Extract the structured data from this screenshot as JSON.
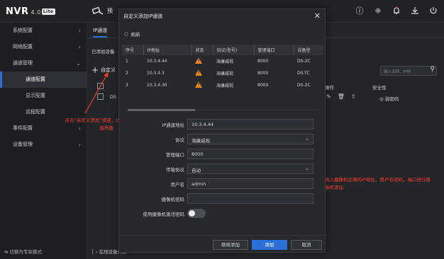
{
  "app": {
    "name": "NVR",
    "version": "4.0",
    "edition": "Lite"
  },
  "header": {
    "preview_label": "预",
    "icons": [
      "info-icon",
      "grid-icon",
      "bell-icon",
      "download-icon",
      "power-icon"
    ]
  },
  "sidebar": {
    "items": [
      {
        "label": "系统配置",
        "arrow": "›"
      },
      {
        "label": "网络配置",
        "arrow": "›"
      },
      {
        "label": "通道管理",
        "arrow": "⌄"
      },
      {
        "label": "通道配置"
      },
      {
        "label": "显示配置"
      },
      {
        "label": "远程配置"
      },
      {
        "label": "事件配置",
        "arrow": "›"
      },
      {
        "label": "设备管理",
        "arrow": "›"
      }
    ],
    "bottom": "⇆ 切换为专家模式"
  },
  "main": {
    "tab": "IP通道",
    "added_label": "已添加设备",
    "add_button": "自定义",
    "search_placeholder": "输入名称、IP地",
    "op_header": "操作",
    "security_header": "安全性",
    "weak_label": "弱密码",
    "bottom_list": "在线设备列表",
    "row_d5": "D5"
  },
  "annotations": {
    "left": "点击“自定义添加”按钮，进去手动添加通道界面",
    "right": "输入摄像机正确的IP地址，用户名密码，端口进行摄像机添加"
  },
  "dialog": {
    "title": "自定义添加IP通道",
    "refresh_label": "刷新",
    "columns": [
      "序号",
      "IP地址",
      "状态",
      "协议(型号)",
      "管理端口",
      "设备型"
    ],
    "rows": [
      {
        "index": "1",
        "ip": "10.3.4.44",
        "protocol": "海康威视",
        "port": "8000",
        "model": "DS-2C"
      },
      {
        "index": "2",
        "ip": "10.3.4.3",
        "protocol": "海康威视",
        "port": "8000",
        "model": "DS-TC"
      },
      {
        "index": "3",
        "ip": "10.3.4.30",
        "protocol": "海康威视",
        "port": "8000",
        "model": "DS-2C"
      }
    ],
    "form": {
      "ip_label": "IP通道地址",
      "ip_value": "10.3.4.44",
      "protocol_label": "协议",
      "protocol_value": "海康威视",
      "port_label": "管理端口",
      "port_value": "8000",
      "transport_label": "传输协议",
      "transport_value": "自动",
      "user_label": "用户名",
      "user_value": "admin",
      "password_label": "摄像机密码",
      "password_value": "",
      "activation_label": "使用摄像机激活密码"
    },
    "buttons": {
      "continue": "继续添加",
      "add": "添加",
      "cancel": "取消"
    }
  },
  "colors": {
    "accent": "#2b6fd8",
    "warning": "#f08a1c",
    "annotation": "#ff3b2e"
  }
}
